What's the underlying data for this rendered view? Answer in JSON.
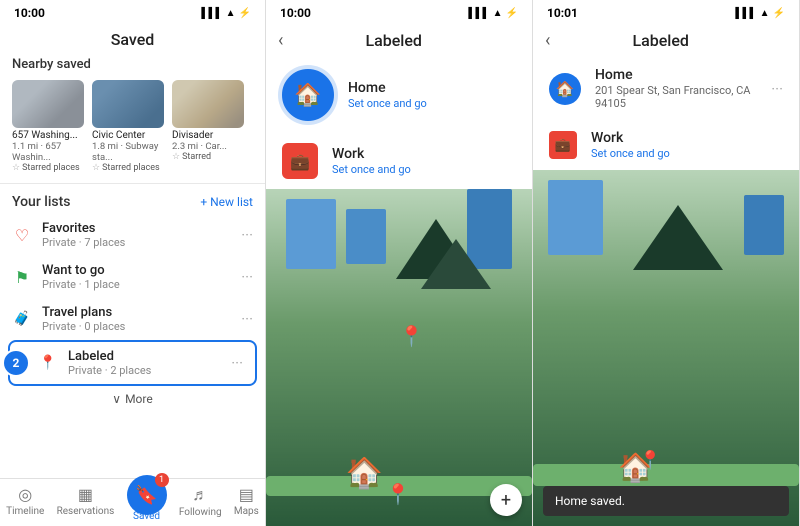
{
  "screen1": {
    "status_time": "10:00",
    "title": "Saved",
    "nearby_title": "Nearby saved",
    "nearby_cards": [
      {
        "name": "657 Washing...",
        "dist": "1.1 mi · 657 Washin...",
        "tag": "Starred places",
        "img": "img1"
      },
      {
        "name": "Civic Center",
        "dist": "1.8 mi · Subway sta...",
        "tag": "Starred places",
        "img": "img2"
      },
      {
        "name": "Divisader",
        "dist": "2.3 mi · Car...",
        "tag": "Starred",
        "img": "img3"
      }
    ],
    "lists_title": "Your lists",
    "new_list_label": "+ New list",
    "lists": [
      {
        "name": "Favorites",
        "sub": "Private · 7 places",
        "icon": "♡",
        "color": "#ea4335"
      },
      {
        "name": "Want to go",
        "sub": "Private · 1 place",
        "icon": "⚑",
        "color": "#34a853"
      },
      {
        "name": "Travel plans",
        "sub": "Private · 0 places",
        "icon": "🧳",
        "color": "#666"
      },
      {
        "name": "Labeled",
        "sub": "Private · 2 places",
        "icon": "📍",
        "color": "#777",
        "highlighted": true,
        "badge": "2"
      }
    ],
    "more_label": "More",
    "tabs": [
      {
        "label": "Timeline",
        "icon": "◎",
        "active": false
      },
      {
        "label": "Reservations",
        "icon": "▦",
        "active": false
      },
      {
        "label": "Following",
        "icon": "♬",
        "active": false
      },
      {
        "label": "Maps",
        "icon": "▤",
        "active": false
      }
    ],
    "saved_tab": {
      "label": "Saved",
      "badge": "1"
    }
  },
  "screen2": {
    "status_time": "10:00",
    "title": "Labeled",
    "back": "‹",
    "places": [
      {
        "name": "Home",
        "action": "Set once and go",
        "type": "home",
        "large": true
      },
      {
        "name": "Work",
        "action": "Set once and go",
        "type": "work"
      }
    ]
  },
  "screen3": {
    "status_time": "10:01",
    "title": "Labeled",
    "back": "‹",
    "places": [
      {
        "name": "Home",
        "address": "201 Spear St, San Francisco, CA 94105",
        "type": "home"
      },
      {
        "name": "Work",
        "action": "Set once and go",
        "type": "work"
      }
    ],
    "toast": "Home saved."
  }
}
